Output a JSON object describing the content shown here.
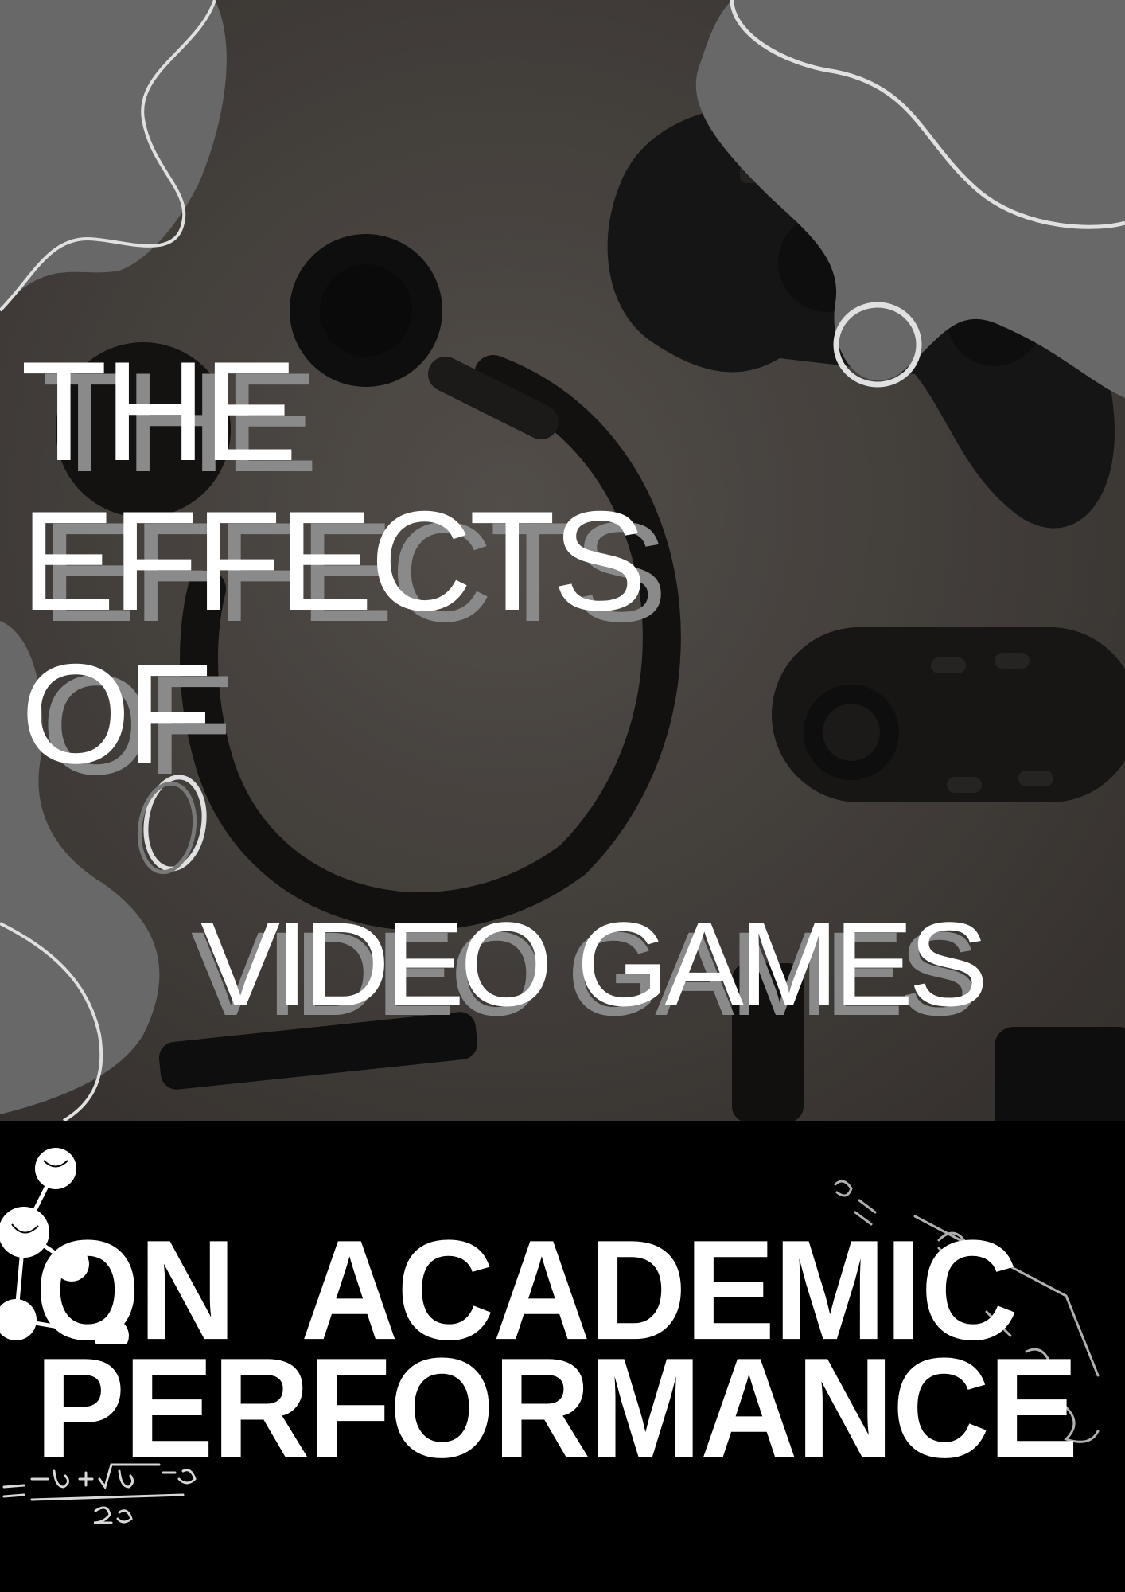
{
  "poster": {
    "title": {
      "line1": "THE",
      "line2": "EFFECTS",
      "line3": "OF",
      "line4": "VIDEO GAMES"
    },
    "subtitle": {
      "line1": "ON ACADEMIC",
      "line2": "PERFORMANCE"
    }
  },
  "colors": {
    "blob": "#777777",
    "title_text": "#ffffff",
    "title_shadow": "#8a8a8a",
    "bottom_band": "#000000",
    "photo_bg": "#4a4541"
  },
  "icons": [
    "gamepad-icon",
    "headphones-icon",
    "vr-remote-icon",
    "molecule-icon",
    "formula-doodle-icon"
  ]
}
